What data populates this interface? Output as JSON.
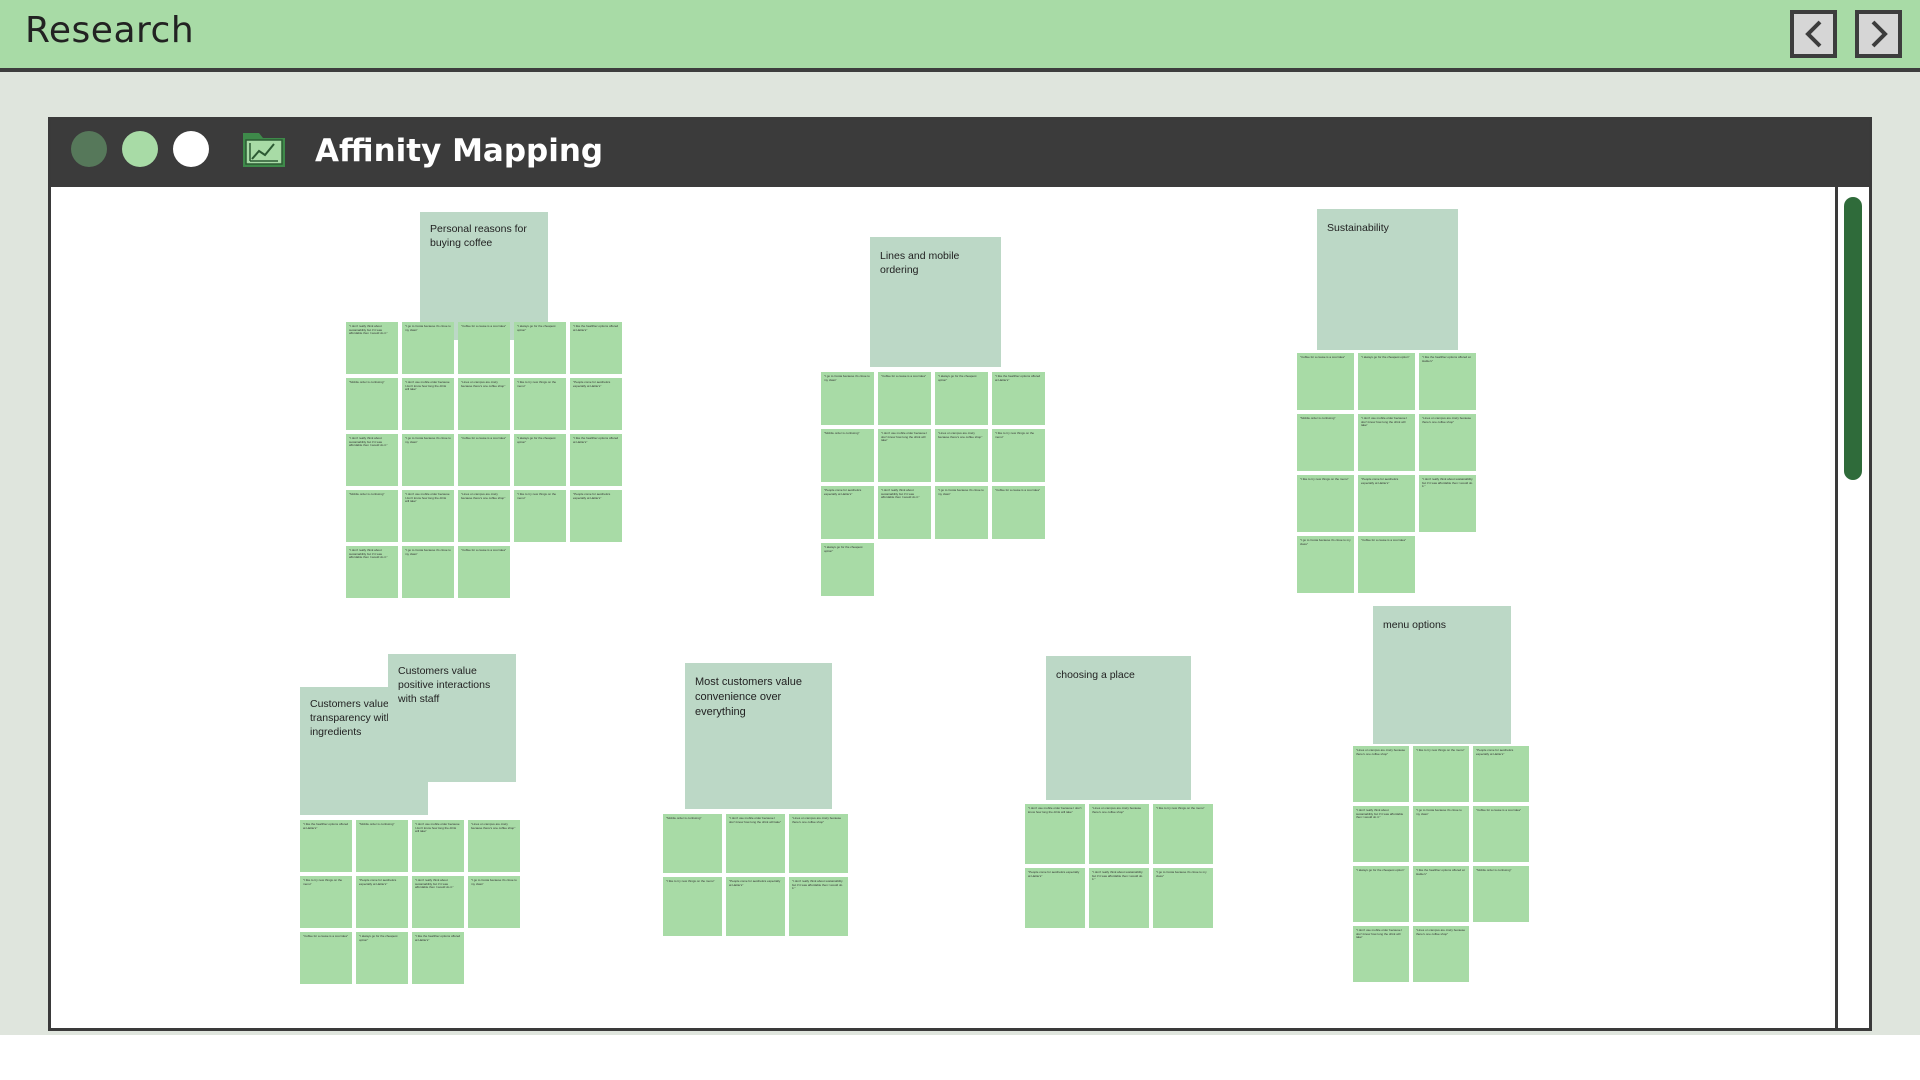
{
  "app": {
    "title": "Research",
    "nav_back_icon": "chevron-left-icon",
    "nav_forward_icon": "chevron-right-icon"
  },
  "window": {
    "title": "Affinity Mapping",
    "icon": "chart-folder-icon",
    "controls": [
      "#56785a",
      "#a8dba6",
      "#ffffff"
    ]
  },
  "colors": {
    "accent": "#a8dba6",
    "header_note": "#bcd8c6",
    "sticky_note": "#a8dba6",
    "window_bar": "#3b3b3b",
    "scroll_thumb": "#2f6b3a"
  },
  "groups": [
    {
      "name": "Personal reasons for buying coffee",
      "note_count": 23
    },
    {
      "name": "Lines and mobile ordering",
      "note_count": 13
    },
    {
      "name": "Sustainability",
      "note_count": 11
    },
    {
      "name": "Customers value positive interactions with staff",
      "note_count": 0
    },
    {
      "name": "Customers value transparency with ingredients",
      "note_count": 11
    },
    {
      "name": "Most customers value convenience over everything",
      "note_count": 6
    },
    {
      "name": "choosing a place",
      "note_count": 6
    },
    {
      "name": "menu options",
      "note_count": 11
    }
  ],
  "notes": [
    "\"I don't really think about sustainability but if it was affordable then I would do it.\"",
    "\"I go to Costa because it's close to my class\"",
    "\"Coffee for a cause is a cool idea\"",
    "\"I always go for the cheapest option\"",
    "\"I like the healthier options offered at Hattie's\"",
    "\"Mobile order is confusing\"",
    "\"I don't use mobile order because I don't know how long the drink will take\"",
    "\"Lines on campus are crazy because there's one coffee shop\"",
    "\"I like to try new things on the menu\"",
    "\"People come for aesthetics especially at Hattie's\""
  ]
}
